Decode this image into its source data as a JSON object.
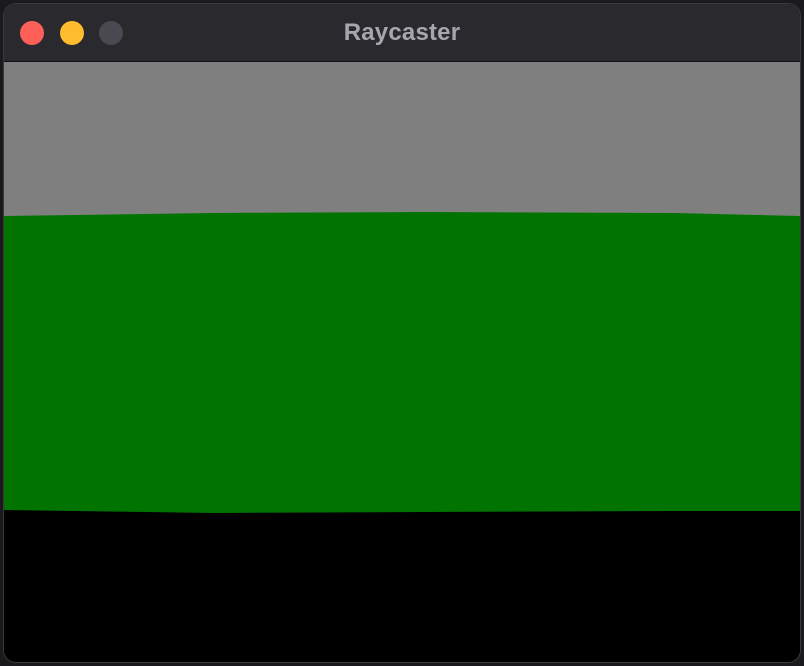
{
  "window": {
    "title": "Raycaster"
  },
  "scene": {
    "colors": {
      "ceiling": "#7f7f7f",
      "wall": "#007300",
      "floor": "#000000"
    }
  }
}
